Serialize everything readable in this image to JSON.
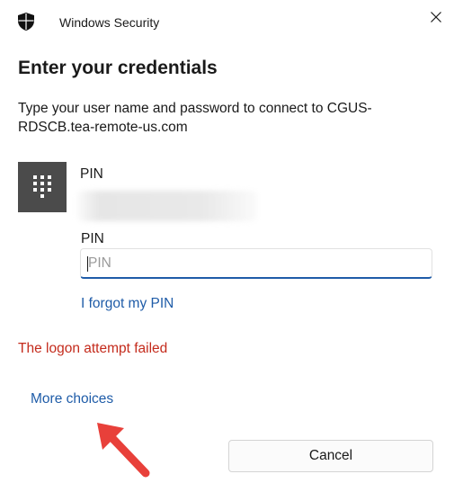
{
  "window": {
    "app_title": "Windows Security",
    "close_icon": "close-icon",
    "app_icon": "shield-icon"
  },
  "dialog": {
    "heading": "Enter your credentials",
    "description": "Type your user name and password to connect to CGUS-RDSCB.tea-remote-us.com"
  },
  "credential": {
    "tile_icon": "keypad-icon",
    "type_label": "PIN",
    "pin_label": "PIN",
    "pin_placeholder": "PIN",
    "pin_value": "",
    "forgot_link": "I forgot my PIN"
  },
  "status": {
    "error": "The logon attempt failed"
  },
  "actions": {
    "more_choices": "More choices",
    "cancel": "Cancel"
  },
  "colors": {
    "accent": "#1f5ca8",
    "error": "#c42b1c",
    "tile": "#4b4b4b",
    "annotation_arrow": "#e8403a"
  }
}
